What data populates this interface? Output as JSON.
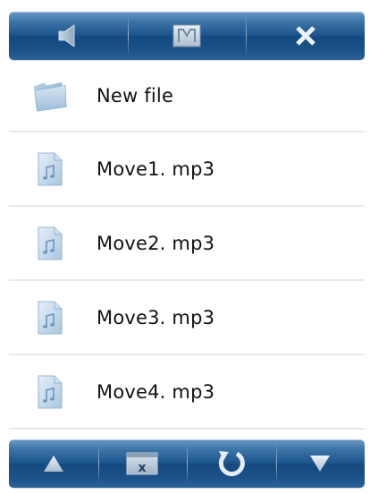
{
  "top_toolbar": {
    "buttons": [
      {
        "icon": "speaker-icon"
      },
      {
        "icon": "mark-icon"
      },
      {
        "icon": "close-icon",
        "label": "X"
      }
    ]
  },
  "files": [
    {
      "name": "New file",
      "icon": "folder-icon"
    },
    {
      "name": "Move1. mp3",
      "icon": "music-file-icon"
    },
    {
      "name": "Move2. mp3",
      "icon": "music-file-icon"
    },
    {
      "name": "Move3. mp3",
      "icon": "music-file-icon"
    },
    {
      "name": "Move4. mp3",
      "icon": "music-file-icon"
    }
  ],
  "bottom_toolbar": {
    "buttons": [
      {
        "icon": "up-arrow-icon"
      },
      {
        "icon": "delete-icon",
        "label": "x"
      },
      {
        "icon": "refresh-icon"
      },
      {
        "icon": "down-arrow-icon"
      }
    ]
  },
  "colors": {
    "toolbar_dark": "#154a80",
    "toolbar_light": "#6a9ac4",
    "icon_blue": "#9fc2df",
    "divider": "#e9e9e9",
    "text": "#111111"
  }
}
